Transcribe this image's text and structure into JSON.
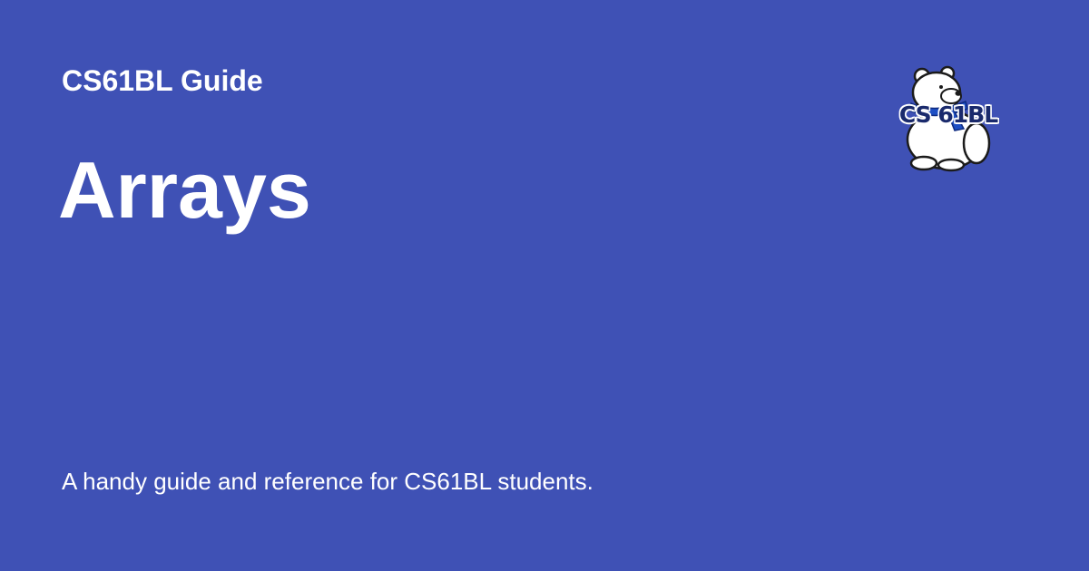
{
  "site_title": "CS61BL Guide",
  "page_title": "Arrays",
  "description": "A handy guide and reference for CS61BL students.",
  "logo": {
    "name": "polar-bear-logo",
    "lettering": "CS 61BL"
  },
  "colors": {
    "background": "#3f51b5",
    "text": "#ffffff",
    "scarf": "#1e4fc4",
    "logo_text": "#1a2a6c"
  }
}
